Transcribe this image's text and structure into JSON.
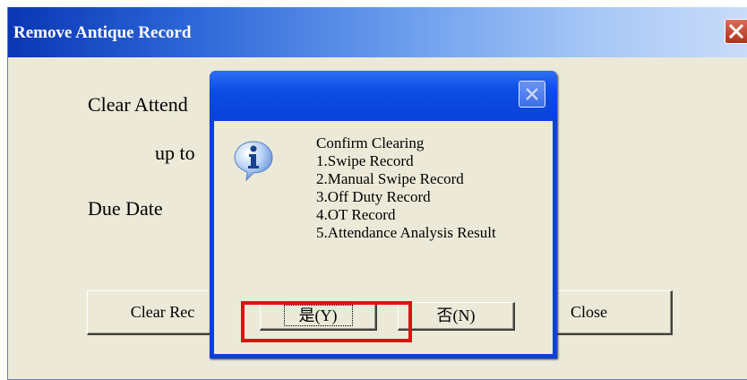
{
  "window": {
    "title": "Remove Antique Record",
    "labels": {
      "clear_attendance": "Clear Attend",
      "up_to": "up to",
      "due_date": "Due Date"
    },
    "buttons": {
      "clear_records": "Clear Rec",
      "close": "Close"
    }
  },
  "dialog": {
    "lines": [
      "Confirm Clearing",
      "1.Swipe Record",
      "2.Manual Swipe Record",
      "3.Off Duty Record",
      "4.OT Record",
      "5.Attendance Analysis Result"
    ],
    "yes_label": "是(Y)",
    "no_label": "否(N)"
  },
  "colors": {
    "titlebar_start": "#0a36b4",
    "dialog_frame": "#0b3fe0",
    "highlight": "#e01010",
    "face": "#ece9d8"
  },
  "icons": [
    "close-icon",
    "info-icon"
  ]
}
